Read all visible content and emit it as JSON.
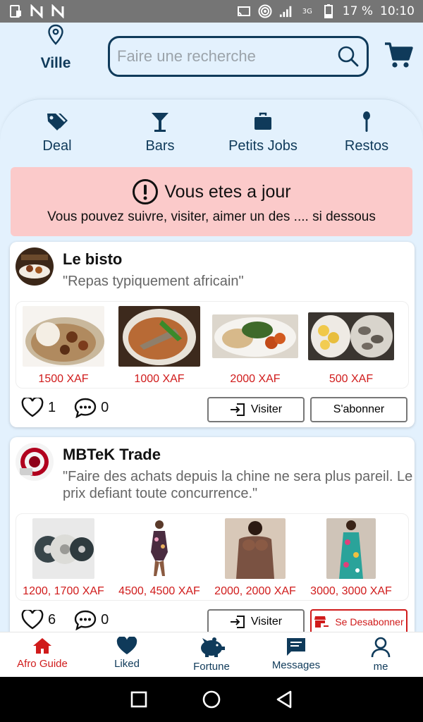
{
  "status_bar": {
    "battery": "17 %",
    "time": "10:10",
    "network": "3G"
  },
  "header": {
    "location_label": "Ville",
    "search_placeholder": "Faire une recherche"
  },
  "categories": [
    {
      "label": "Deal",
      "icon": "tag-icon"
    },
    {
      "label": "Bars",
      "icon": "cocktail-icon"
    },
    {
      "label": "Petits Jobs",
      "icon": "briefcase-icon"
    },
    {
      "label": "Restos",
      "icon": "spoon-icon"
    }
  ],
  "banner": {
    "title": "Vous etes a jour",
    "subtitle": "Vous pouvez suivre, visiter, aimer un des .... si dessous"
  },
  "shops": [
    {
      "name": "Le bisto",
      "description": "\"Repas typiquement africain\"",
      "products": [
        {
          "price": "1500 XAF"
        },
        {
          "price": "1000 XAF"
        },
        {
          "price": "2000 XAF"
        },
        {
          "price": "500 XAF"
        }
      ],
      "likes": "1",
      "comments": "0",
      "visit_label": "Visiter",
      "follow_label": "S'abonner"
    },
    {
      "name": "MBTeK Trade",
      "description_line1": "\"Faire des achats depuis la chine ne sera plus pareil. Le",
      "description_line2": "prix defiant toute concurrence.\"",
      "products": [
        {
          "price": "1200, 1700 XAF"
        },
        {
          "price": "4500, 4500 XAF"
        },
        {
          "price": "2000, 2000 XAF"
        },
        {
          "price": "3000, 3000 XAF"
        }
      ],
      "likes": "6",
      "comments": "0",
      "visit_label": "Visiter",
      "unfollow_label": "Se Desabonner"
    }
  ],
  "bottom_nav": [
    {
      "label": "Afro Guide",
      "active": true
    },
    {
      "label": "Liked"
    },
    {
      "label": "Fortune"
    },
    {
      "label": "Messages"
    },
    {
      "label": "me"
    }
  ],
  "colors": {
    "primary": "#0f3a5a",
    "accent": "#d01b1b",
    "background": "#e3f1fd",
    "banner": "#fbcaca"
  }
}
